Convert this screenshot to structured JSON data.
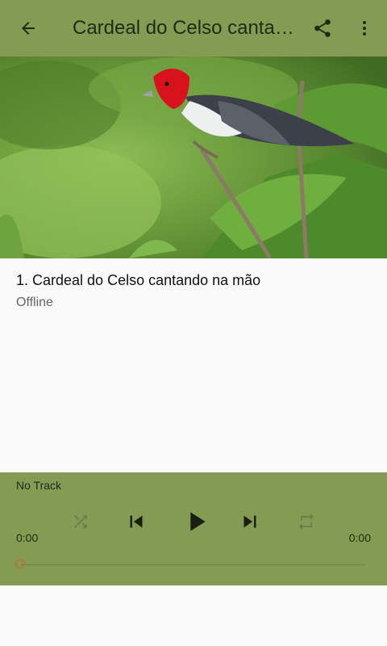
{
  "app_bar": {
    "title": "Cardeal do Celso cantando na mão",
    "back_icon": "arrow-left-icon",
    "share_icon": "share-icon",
    "more_icon": "more-vert-icon",
    "color": "#849b54"
  },
  "tracks": [
    {
      "title": "1. Cardeal do Celso cantando na mão",
      "status": "Offline"
    }
  ],
  "player": {
    "now_playing": "No Track",
    "elapsed": "0:00",
    "duration": "0:00",
    "progress": 0,
    "controls": [
      "shuffle-icon",
      "skip-previous-icon",
      "play-icon",
      "skip-next-icon",
      "repeat-icon"
    ]
  }
}
